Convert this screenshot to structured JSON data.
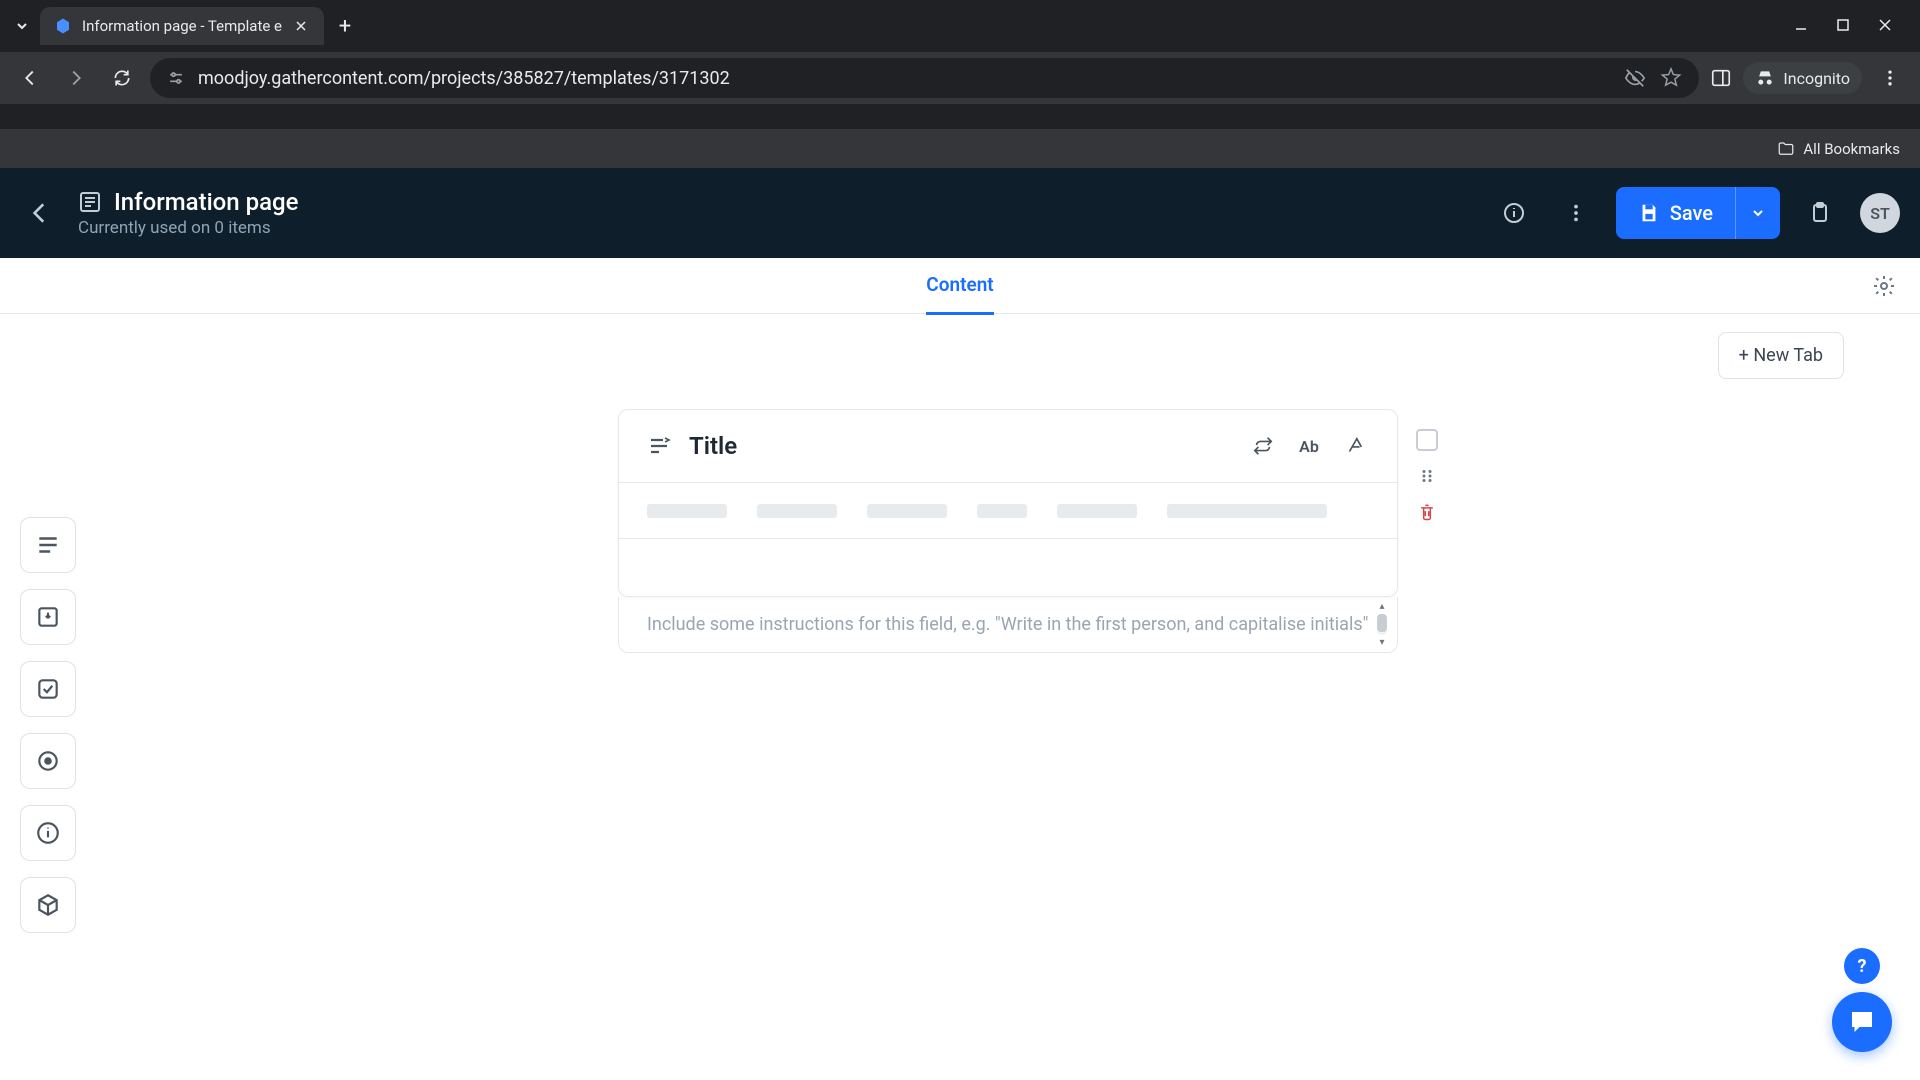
{
  "browser": {
    "tab_title": "Information page - Template e",
    "url": "moodjoy.gathercontent.com/projects/385827/templates/3171302",
    "incognito_label": "Incognito",
    "bookmarks_label": "All Bookmarks"
  },
  "header": {
    "title": "Information page",
    "subtitle": "Currently used on 0 items",
    "save_label": "Save",
    "avatar_initials": "ST"
  },
  "content": {
    "tab_label": "Content",
    "new_tab_label": "+ New Tab"
  },
  "field": {
    "title": "Title",
    "ab_label": "Ab",
    "instruction_placeholder": "Include some instructions for this field, e.g. \"Write in the first person, and capitalise initials\""
  },
  "help": {
    "badge": "?"
  }
}
